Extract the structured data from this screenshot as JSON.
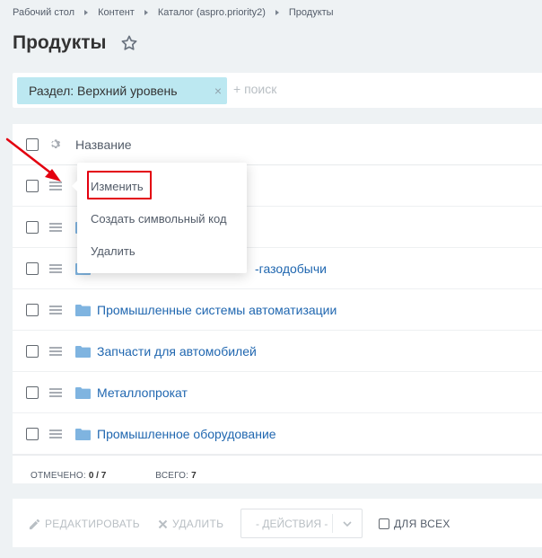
{
  "breadcrumb": {
    "items": [
      "Рабочий стол",
      "Контент",
      "Каталог (aspro.priority2)",
      "Продукты"
    ]
  },
  "header": {
    "title": "Продукты",
    "favorite_icon": "star-icon"
  },
  "filter": {
    "chip_label": "Раздел: Верхний уровень",
    "chip_close": "×",
    "search_placeholder": "+ поиск"
  },
  "grid": {
    "column_title": "Название",
    "rows": [
      {
        "name": ""
      },
      {
        "name": ""
      },
      {
        "name": "-газодобычи"
      },
      {
        "name": "Промышленные системы автоматизации"
      },
      {
        "name": "Запчасти для автомобилей"
      },
      {
        "name": "Металлопрокат"
      },
      {
        "name": "Промышленное оборудование"
      }
    ],
    "footer": {
      "selected_label": "ОТМЕЧЕНО:",
      "selected_value": "0 / 7",
      "total_label": "ВСЕГО:",
      "total_value": "7"
    }
  },
  "context_menu": {
    "items": [
      "Изменить",
      "Создать символьный код",
      "Удалить"
    ],
    "highlighted": "Изменить"
  },
  "actions": {
    "edit_label": "РЕДАКТИРОВАТЬ",
    "delete_label": "УДАЛИТЬ",
    "select_value": "- ДЕЙСТВИЯ -",
    "for_all_label": "ДЛЯ ВСЕХ"
  },
  "colors": {
    "link": "#2067b0",
    "chip": "#bce8f1",
    "highlight": "#e3000f",
    "folder": "#7fb4e0"
  }
}
